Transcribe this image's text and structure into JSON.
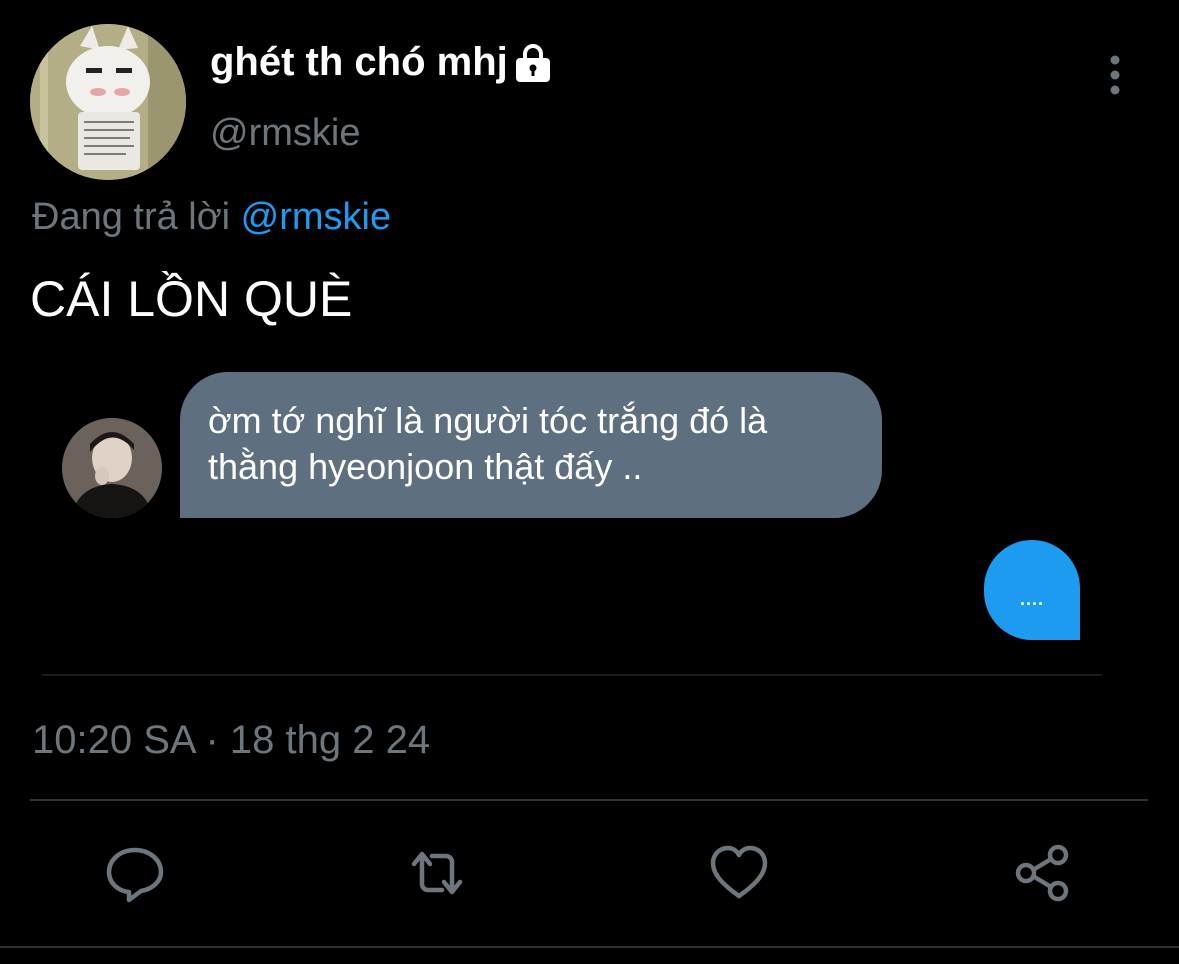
{
  "profile": {
    "display_name": "ghét th chó mhj",
    "handle": "@rmskie"
  },
  "reply_context": {
    "prefix": "Đang trả lời ",
    "mention": "@rmskie"
  },
  "tweet_text": "CÁI LỒN QUÈ",
  "image": {
    "gray_bubble_text": "ờm tớ nghĩ là người tóc trắng đó là thằng hyeonjoon thật đấy ..",
    "blue_bubble_text": "....",
    "colors": {
      "gray_bubble": "#5e6f80",
      "blue_bubble": "#1d9bf0"
    }
  },
  "timestamp": "10:20 SA · 18 thg 2 24",
  "actions": [
    {
      "icon": "reply-icon"
    },
    {
      "icon": "retweet-icon"
    },
    {
      "icon": "like-icon"
    },
    {
      "icon": "share-icon"
    }
  ],
  "colors": {
    "background": "#000000",
    "secondary_text": "#6e767d",
    "accent": "#1d9bf0"
  }
}
